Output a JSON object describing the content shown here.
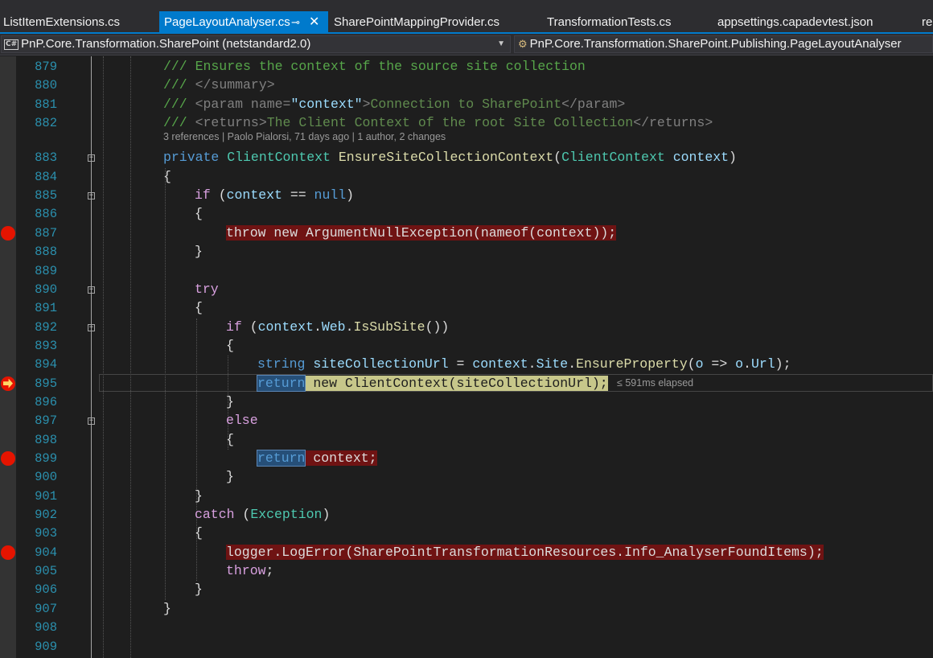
{
  "tabs": [
    {
      "label": "ListItemExtensions.cs",
      "active": false
    },
    {
      "label": "PageLayoutAnalyser.cs",
      "active": true,
      "pin_icon": "pin-icon",
      "close_icon": "close-icon"
    },
    {
      "label": "SharePointMappingProvider.cs",
      "active": false
    },
    {
      "label": "TransformationTests.cs",
      "active": false
    },
    {
      "label": "appsettings.capadevtest.json",
      "active": false
    },
    {
      "label": "re",
      "active": false
    }
  ],
  "navbar": {
    "project_badge": "C#",
    "project": "PnP.Core.Transformation.SharePoint (netstandard2.0)",
    "class": "PnP.Core.Transformation.SharePoint.Publishing.PageLayoutAnalyser"
  },
  "codelens": "3 references | Paolo Pialorsi, 71 days ago | 1 author, 2 changes",
  "elapsed": "≤ 591ms elapsed",
  "colors": {
    "accent": "#007acc",
    "breakpoint": "#e51400",
    "line_number": "#2b91af"
  },
  "lines": [
    {
      "n": "879",
      "tokens": [
        {
          "c": "c-com",
          "t": "/// Ensures the context of the source site collection"
        }
      ]
    },
    {
      "n": "880",
      "tokens": [
        {
          "c": "c-com",
          "t": "/// "
        },
        {
          "c": "c-xml",
          "t": "</summary>"
        }
      ]
    },
    {
      "n": "881",
      "tokens": [
        {
          "c": "c-com",
          "t": "/// "
        },
        {
          "c": "c-xml",
          "t": "<param "
        },
        {
          "c": "c-xml",
          "t": "name="
        },
        {
          "c": "c-var",
          "t": "\"context\""
        },
        {
          "c": "c-xml",
          "t": ">"
        },
        {
          "c": "c-doc",
          "t": "Connection to SharePoint"
        },
        {
          "c": "c-xml",
          "t": "</param>"
        }
      ]
    },
    {
      "n": "882",
      "tokens": [
        {
          "c": "c-com",
          "t": "/// "
        },
        {
          "c": "c-xml",
          "t": "<returns>"
        },
        {
          "c": "c-doc",
          "t": "The Client Context of the root Site Collection"
        },
        {
          "c": "c-xml",
          "t": "</returns>"
        }
      ]
    },
    {
      "n": "883",
      "tokens": [
        {
          "c": "c-kw",
          "t": "private "
        },
        {
          "c": "c-type",
          "t": "ClientContext "
        },
        {
          "c": "c-meth",
          "t": "EnsureSiteCollectionContext"
        },
        {
          "c": "c-txt",
          "t": "("
        },
        {
          "c": "c-type",
          "t": "ClientContext "
        },
        {
          "c": "c-var",
          "t": "context"
        },
        {
          "c": "c-txt",
          "t": ")"
        }
      ]
    },
    {
      "n": "884",
      "tokens": [
        {
          "c": "c-txt",
          "t": "{"
        }
      ]
    },
    {
      "n": "885",
      "tokens": [
        {
          "c": "c-ctl",
          "t": "if "
        },
        {
          "c": "c-txt",
          "t": "("
        },
        {
          "c": "c-var",
          "t": "context"
        },
        {
          "c": "c-txt",
          "t": " == "
        },
        {
          "c": "c-kw",
          "t": "null"
        },
        {
          "c": "c-txt",
          "t": ")"
        }
      ]
    },
    {
      "n": "886",
      "tokens": [
        {
          "c": "c-txt",
          "t": "{"
        }
      ]
    },
    {
      "n": "887",
      "tokens": [
        {
          "c": "c-txt",
          "t": "throw new ArgumentNullException(nameof(context));"
        }
      ]
    },
    {
      "n": "888",
      "tokens": [
        {
          "c": "c-txt",
          "t": "}"
        }
      ]
    },
    {
      "n": "889",
      "tokens": []
    },
    {
      "n": "890",
      "tokens": [
        {
          "c": "c-ctl",
          "t": "try"
        }
      ]
    },
    {
      "n": "891",
      "tokens": [
        {
          "c": "c-txt",
          "t": "{"
        }
      ]
    },
    {
      "n": "892",
      "tokens": [
        {
          "c": "c-ctl",
          "t": "if "
        },
        {
          "c": "c-txt",
          "t": "("
        },
        {
          "c": "c-var",
          "t": "context"
        },
        {
          "c": "c-txt",
          "t": "."
        },
        {
          "c": "c-var",
          "t": "Web"
        },
        {
          "c": "c-txt",
          "t": "."
        },
        {
          "c": "c-meth",
          "t": "IsSubSite"
        },
        {
          "c": "c-txt",
          "t": "())"
        }
      ]
    },
    {
      "n": "893",
      "tokens": [
        {
          "c": "c-txt",
          "t": "{"
        }
      ]
    },
    {
      "n": "894",
      "tokens": [
        {
          "c": "c-kw",
          "t": "string "
        },
        {
          "c": "c-var",
          "t": "siteCollectionUrl"
        },
        {
          "c": "c-txt",
          "t": " = "
        },
        {
          "c": "c-var",
          "t": "context"
        },
        {
          "c": "c-txt",
          "t": "."
        },
        {
          "c": "c-var",
          "t": "Site"
        },
        {
          "c": "c-txt",
          "t": "."
        },
        {
          "c": "c-meth",
          "t": "EnsureProperty"
        },
        {
          "c": "c-txt",
          "t": "("
        },
        {
          "c": "c-var",
          "t": "o"
        },
        {
          "c": "c-txt",
          "t": " => "
        },
        {
          "c": "c-var",
          "t": "o"
        },
        {
          "c": "c-txt",
          "t": "."
        },
        {
          "c": "c-var",
          "t": "Url"
        },
        {
          "c": "c-txt",
          "t": ");"
        }
      ]
    },
    {
      "n": "895",
      "tokens": []
    },
    {
      "n": "896",
      "tokens": [
        {
          "c": "c-txt",
          "t": "}"
        }
      ]
    },
    {
      "n": "897",
      "tokens": [
        {
          "c": "c-ctl",
          "t": "else"
        }
      ]
    },
    {
      "n": "898",
      "tokens": [
        {
          "c": "c-txt",
          "t": "{"
        }
      ]
    },
    {
      "n": "899",
      "tokens": []
    },
    {
      "n": "900",
      "tokens": [
        {
          "c": "c-txt",
          "t": "}"
        }
      ]
    },
    {
      "n": "901",
      "tokens": [
        {
          "c": "c-txt",
          "t": "}"
        }
      ]
    },
    {
      "n": "902",
      "tokens": [
        {
          "c": "c-ctl",
          "t": "catch "
        },
        {
          "c": "c-txt",
          "t": "("
        },
        {
          "c": "c-type",
          "t": "Exception"
        },
        {
          "c": "c-txt",
          "t": ")"
        }
      ]
    },
    {
      "n": "903",
      "tokens": [
        {
          "c": "c-txt",
          "t": "{"
        }
      ]
    },
    {
      "n": "904",
      "tokens": [
        {
          "c": "c-txt",
          "t": "logger.LogError(SharePointTransformationResources.Info_AnalyserFoundItems);"
        }
      ]
    },
    {
      "n": "905",
      "tokens": [
        {
          "c": "c-ctl",
          "t": "throw"
        },
        {
          "c": "c-txt",
          "t": ";"
        }
      ]
    },
    {
      "n": "906",
      "tokens": [
        {
          "c": "c-txt",
          "t": "}"
        }
      ]
    },
    {
      "n": "907",
      "tokens": [
        {
          "c": "c-txt",
          "t": "}"
        }
      ]
    },
    {
      "n": "908",
      "tokens": []
    },
    {
      "n": "909",
      "tokens": []
    }
  ],
  "line_895": {
    "kw": "return",
    "rest": " new ClientContext(siteCollectionUrl);"
  },
  "line_899": {
    "kw": "return",
    "rest": " context;"
  }
}
